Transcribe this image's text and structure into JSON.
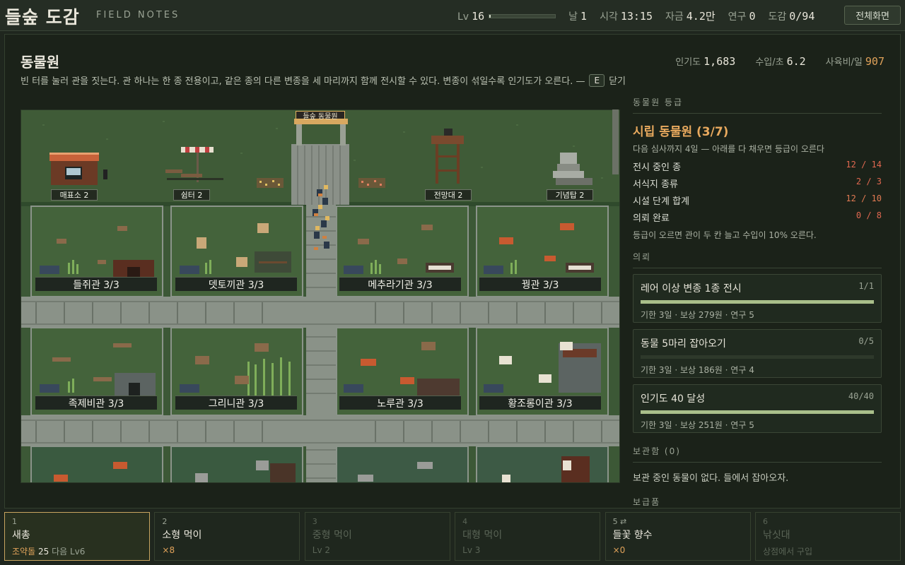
{
  "top": {
    "title": "들숲 도감",
    "subtitle": "FIELD NOTES",
    "level_label": "Lv",
    "level": "16",
    "xp_fraction": 0.02,
    "day_label": "날",
    "day": "1",
    "time_label": "시각",
    "time": "13:15",
    "money_label": "자금",
    "money": "4.2만",
    "research_label": "연구",
    "research": "0",
    "dex_label": "도감",
    "dex": "0/94",
    "fullscreen": "전체화면"
  },
  "zoo": {
    "title": "동물원",
    "popularity_label": "인기도",
    "popularity": "1,683",
    "income_label": "수입/초",
    "income": "6.2",
    "feed_label": "사육비/일",
    "feed": "907",
    "desc": "빈 터를 눌러 관을 짓는다. 관 하나는 한 종 전용이고, 같은 종의 다른 변종을 세 마리까지 함께 전시할 수 있다. 변종이 섞일수록 인기도가 오른다. —",
    "close_key": "E",
    "close_label": "닫기"
  },
  "map": {
    "gate_sign": "들숲 동물원",
    "facilities": [
      {
        "label": "매표소 2"
      },
      {
        "label": "쉼터 2"
      },
      {
        "label": "전망대 2"
      },
      {
        "label": "기념탑 2"
      }
    ],
    "enclosures": [
      {
        "label": "들쥐관 3/3"
      },
      {
        "label": "뎃토끼관 3/3"
      },
      {
        "label": "메추라기관 3/3"
      },
      {
        "label": "꿩관 3/3"
      },
      {
        "label": "족제비관 3/3"
      },
      {
        "label": "그리니관 3/3"
      },
      {
        "label": "노루관 3/3"
      },
      {
        "label": "황조롱이관 3/3"
      }
    ]
  },
  "side": {
    "grade_header": "동물원 등급",
    "grade": "시립 동물원 (3/7)",
    "grade_sub": "다음 심사까지 4일 — 아래를 다 채우면 등급이 오른다",
    "requirements": [
      {
        "label": "전시 중인 종",
        "value": "12 / 14"
      },
      {
        "label": "서식지 종류",
        "value": "2 / 3"
      },
      {
        "label": "시설 단계 합계",
        "value": "12 / 10"
      },
      {
        "label": "의뢰 완료",
        "value": "0 / 8"
      }
    ],
    "grade_foot": "등급이 오르면 관이 두 칸 늘고 수입이 10% 오른다.",
    "quest_header": "의뢰",
    "quests": [
      {
        "title": "레어 이상 변종 1종 전시",
        "progress": "1/1",
        "fraction": 1.0,
        "meta": "기한 3일 · 보상 279원 · 연구 5"
      },
      {
        "title": "동물 5마리 잡아오기",
        "progress": "0/5",
        "fraction": 0.0,
        "meta": "기한 3일 · 보상 186원 · 연구 4"
      },
      {
        "title": "인기도 40 달성",
        "progress": "40/40",
        "fraction": 1.0,
        "meta": "기한 3일 · 보상 251원 · 연구 5"
      }
    ],
    "storage_header": "보관함 (0)",
    "storage_text": "보관 중인 동물이 없다. 들에서 잡아오자.",
    "supply_header": "보급품"
  },
  "hotbar": [
    {
      "num": "1",
      "title": "새총",
      "sub_label": "조약돌",
      "sub_value": "25",
      "sub_extra": "다음 Lv6",
      "selected": true,
      "dim": false
    },
    {
      "num": "2",
      "title": "소형 먹이",
      "sub_label": "×8",
      "sub_value": "",
      "sub_extra": "",
      "selected": false,
      "dim": false
    },
    {
      "num": "3",
      "title": "중형 먹이",
      "sub_label": "Lv 2",
      "sub_value": "",
      "sub_extra": "",
      "selected": false,
      "dim": true
    },
    {
      "num": "4",
      "title": "대형 먹이",
      "sub_label": "Lv 3",
      "sub_value": "",
      "sub_extra": "",
      "selected": false,
      "dim": true
    },
    {
      "num": "5 ⇄",
      "title": "들꽃 향수",
      "sub_label": "×0",
      "sub_value": "",
      "sub_extra": "",
      "selected": false,
      "dim": false
    },
    {
      "num": "6",
      "title": "낚싯대",
      "sub_label": "상점에서 구입",
      "sub_value": "",
      "sub_extra": "",
      "selected": false,
      "dim": true
    }
  ]
}
